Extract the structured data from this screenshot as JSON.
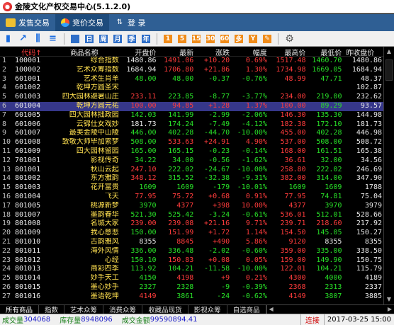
{
  "window": {
    "title": "金陵文化产权交易中心(5.1.2.0)",
    "icon": "app-logo-icon"
  },
  "tabs": [
    {
      "label": "发售交易",
      "icon": "user-icon",
      "active": false
    },
    {
      "label": "竞价交易",
      "icon": "pie-chart-icon",
      "active": true
    },
    {
      "label": "登 录",
      "icon": "switch-arrows-icon",
      "active": false
    }
  ],
  "toolbar": {
    "items": [
      {
        "name": "chart-view-icon",
        "glyph": "▮",
        "style": "chart"
      },
      {
        "name": "trend-icon",
        "glyph": "↗",
        "style": "chart"
      },
      {
        "name": "candle-icon",
        "glyph": "⫼",
        "style": "chart"
      },
      {
        "name": "list-icon",
        "glyph": "≡",
        "style": "chart"
      },
      {
        "name": "grid-icon",
        "glyph": "",
        "style": "blue"
      },
      {
        "name": "day-icon",
        "glyph": "日",
        "style": "blue"
      },
      {
        "name": "week-icon",
        "glyph": "周",
        "style": "blue"
      },
      {
        "name": "month-icon",
        "glyph": "月",
        "style": "blue"
      },
      {
        "name": "quarter-icon",
        "glyph": "季",
        "style": "blue"
      },
      {
        "name": "year-icon",
        "glyph": "年",
        "style": "blue"
      },
      {
        "name": "m1-icon",
        "glyph": "1",
        "style": "orange"
      },
      {
        "name": "m5-icon",
        "glyph": "5",
        "style": "orange"
      },
      {
        "name": "m15-icon",
        "glyph": "15",
        "style": "orange"
      },
      {
        "name": "m30-icon",
        "glyph": "30",
        "style": "orange"
      },
      {
        "name": "m60-icon",
        "glyph": "60",
        "style": "orange"
      },
      {
        "name": "multi-icon",
        "glyph": "多",
        "style": "orange"
      },
      {
        "name": "custom-icon",
        "glyph": "Y",
        "style": "orange"
      },
      {
        "name": "edit-icon",
        "glyph": "✎",
        "style": "orange"
      },
      {
        "name": "settings-icon",
        "glyph": "⚙",
        "style": "gear"
      }
    ]
  },
  "table": {
    "headers": [
      "",
      "代码↑",
      "商品名称",
      "开盘价",
      "最新",
      "涨跌",
      "幅度",
      "最高价",
      "最低价",
      "昨收盘价 >>"
    ],
    "selected_index": 5,
    "rows": [
      [
        "1",
        "100001",
        "综合指数",
        "1480.86",
        "1491.06",
        "+10.20",
        "0.69%",
        "1517.48",
        "1460.70",
        "1480.86"
      ],
      [
        "2",
        "100002",
        "艺术众筹指数",
        "1684.94",
        "1706.80",
        "+21.86",
        "1.30%",
        "1734.98",
        "1669.05",
        "1684.94"
      ],
      [
        "3",
        "601001",
        "艺术生肖羊",
        "48.00",
        "48.00",
        "-0.37",
        "-0.76%",
        "48.99",
        "47.71",
        "48.37"
      ],
      [
        "4",
        "601002",
        "乾坤方圆圣宋",
        "",
        "",
        "",
        "",
        "",
        "",
        "102.87"
      ],
      [
        "5",
        "601003",
        "四大园林避暑山庄",
        "233.11",
        "223.85",
        "-8.77",
        "-3.77%",
        "234.00",
        "219.00",
        "232.62"
      ],
      [
        "6",
        "601004",
        "乾坤方圆元祐",
        "100.00",
        "94.85",
        "+1.28",
        "1.37%",
        "100.00",
        "89.29",
        "93.57"
      ],
      [
        "7",
        "601005",
        "四大园林拙政园",
        "142.03",
        "141.99",
        "-2.99",
        "-2.06%",
        "146.30",
        "135.30",
        "144.98"
      ],
      [
        "8",
        "601006",
        "云锦仕女戏妙",
        "181.73",
        "174.24",
        "-7.49",
        "-4.12%",
        "182.38",
        "172.10",
        "181.73"
      ],
      [
        "9",
        "601007",
        "最美金陵中山陵",
        "446.00",
        "402.28",
        "-44.70",
        "-10.00%",
        "455.00",
        "402.28",
        "446.98"
      ],
      [
        "10",
        "601008",
        "致敬大师毕加索梦",
        "508.00",
        "533.63",
        "+24.91",
        "4.90%",
        "537.00",
        "508.00",
        "508.72"
      ],
      [
        "11",
        "601009",
        "四大园林留园",
        "165.00",
        "165.15",
        "-0.23",
        "-0.14%",
        "168.00",
        "161.51",
        "165.38"
      ],
      [
        "12",
        "701001",
        "影视传奇",
        "34.22",
        "34.00",
        "-0.56",
        "-1.62%",
        "36.61",
        "32.00",
        "34.56"
      ],
      [
        "13",
        "801001",
        "秋山云起",
        "247.10",
        "222.02",
        "-24.67",
        "-10.00%",
        "258.80",
        "222.02",
        "246.69"
      ],
      [
        "14",
        "801002",
        "东方雅韵",
        "348.12",
        "315.52",
        "-32.38",
        "-9.31%",
        "382.00",
        "314.00",
        "347.90"
      ],
      [
        "15",
        "801003",
        "花开富贵",
        "1609",
        "1609",
        "-179",
        "-10.01%",
        "1609",
        "1609",
        "1788"
      ],
      [
        "16",
        "801004",
        "飞天",
        "77.95",
        "75.72",
        "+0.68",
        "0.91%",
        "77.95",
        "74.81",
        "75.04"
      ],
      [
        "17",
        "801005",
        "桃源新梦",
        "3970",
        "4377",
        "+398",
        "10.00%",
        "4377",
        "3970",
        "3979"
      ],
      [
        "18",
        "801007",
        "墨韵春华",
        "521.30",
        "525.42",
        "-3.24",
        "-0.61%",
        "536.01",
        "512.01",
        "528.66"
      ],
      [
        "19",
        "801008",
        "名城大家",
        "239.00",
        "239.08",
        "+21.16",
        "9.71%",
        "239.71",
        "218.60",
        "217.92"
      ],
      [
        "20",
        "801009",
        "我心慈悲",
        "150.00",
        "151.99",
        "+1.72",
        "1.14%",
        "154.50",
        "145.05",
        "150.27"
      ],
      [
        "21",
        "801010",
        "古韵雅风",
        "8355",
        "8845",
        "+490",
        "5.86%",
        "9120",
        "8355",
        "8355"
      ],
      [
        "22",
        "801011",
        "海外风情",
        "336.00",
        "336.48",
        "-2.02",
        "-0.60%",
        "359.00",
        "335.00",
        "338.50"
      ],
      [
        "23",
        "801012",
        "心经",
        "150.10",
        "150.83",
        "+0.08",
        "0.05%",
        "159.00",
        "149.90",
        "150.75"
      ],
      [
        "24",
        "801013",
        "商彩四季",
        "113.92",
        "104.21",
        "-11.58",
        "-10.00%",
        "122.01",
        "104.21",
        "115.79"
      ],
      [
        "25",
        "801014",
        "妙手天工",
        "4150",
        "4198",
        "+9",
        "0.21%",
        "4300",
        "4000",
        "4189"
      ],
      [
        "26",
        "801015",
        "墨心妙手",
        "2327",
        "2328",
        "-9",
        "-0.39%",
        "2368",
        "2313",
        "2337"
      ],
      [
        "27",
        "801016",
        "墨语乾坤",
        "4149",
        "3861",
        "-24",
        "-0.62%",
        "4149",
        "3807",
        "3885"
      ]
    ]
  },
  "bottom_tabs": [
    "所有商品",
    "指数",
    "艺术众筹",
    "消费众筹",
    "收藏品现货",
    "影视众筹",
    "自选商品"
  ],
  "bottom_tab_active": 0,
  "status": {
    "deal_qty_label": "成交量",
    "deal_qty": "304068",
    "stock_label": "库存量",
    "stock": "8948096",
    "amount_label": "成交金额",
    "amount": "99590894.41",
    "connection": "连接",
    "datetime": "2017-03-25 15:00"
  },
  "colors": {
    "up": "#ff3c3c",
    "down": "#28e028",
    "flat": "#e8e8e8",
    "name": "#ffe050",
    "selected": "#36378a"
  }
}
